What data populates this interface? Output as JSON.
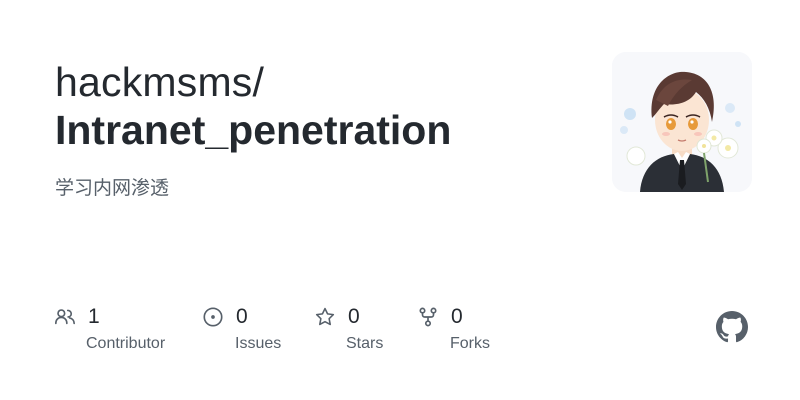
{
  "repo": {
    "owner": "hackmsms/",
    "name": "Intranet_penetration",
    "description": "学习内网渗透"
  },
  "stats": {
    "contributors": {
      "value": "1",
      "label": "Contributor",
      "icon": "people-icon"
    },
    "issues": {
      "value": "0",
      "label": "Issues",
      "icon": "issue-opened-icon"
    },
    "stars": {
      "value": "0",
      "label": "Stars",
      "icon": "star-icon"
    },
    "forks": {
      "value": "0",
      "label": "Forks",
      "icon": "repo-forked-icon"
    }
  },
  "branding": {
    "logo_icon": "github-mark-icon",
    "avatar_icon": "owner-avatar"
  },
  "colors": {
    "text_primary": "#24292f",
    "text_secondary": "#57606a",
    "icon": "#57606a",
    "logo": "#57606a"
  }
}
